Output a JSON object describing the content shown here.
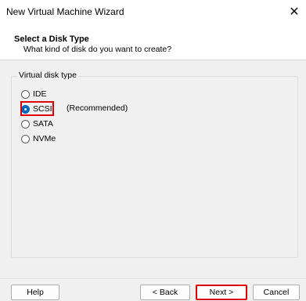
{
  "window": {
    "title": "New Virtual Machine Wizard"
  },
  "header": {
    "title": "Select a Disk Type",
    "subtitle": "What kind of disk do you want to create?"
  },
  "disk_group": {
    "label": "Virtual disk type",
    "options": [
      {
        "label": "IDE",
        "checked": false
      },
      {
        "label": "SCSI",
        "checked": true
      },
      {
        "label": "SATA",
        "checked": false
      },
      {
        "label": "NVMe",
        "checked": false
      }
    ],
    "recommended_note": "(Recommended)"
  },
  "buttons": {
    "help": "Help",
    "back": "< Back",
    "next": "Next >",
    "cancel": "Cancel"
  },
  "colors": {
    "accent": "#0067c0",
    "highlight": "#e00000"
  }
}
